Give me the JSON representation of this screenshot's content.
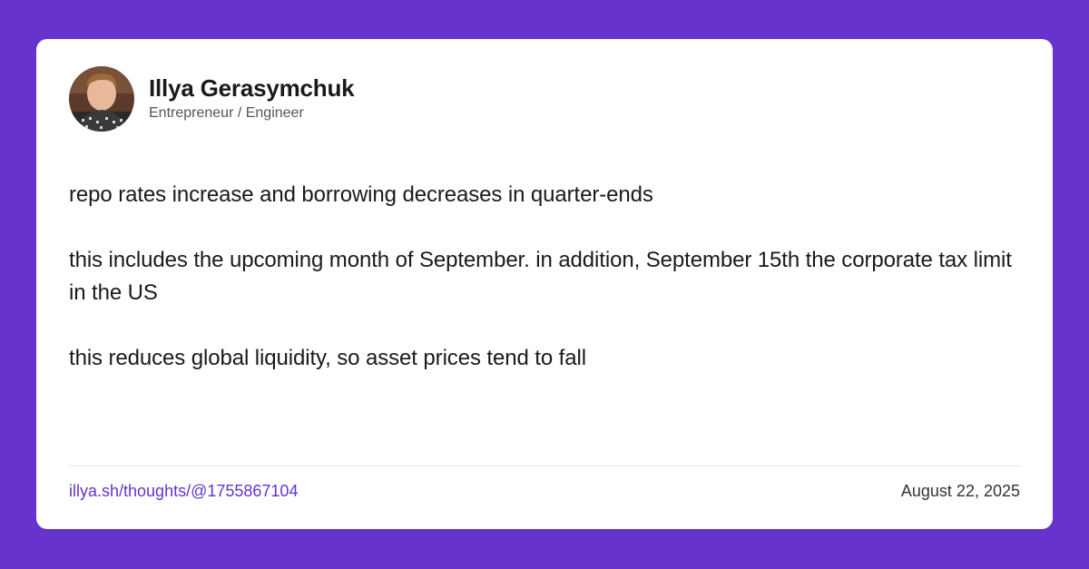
{
  "author": {
    "name": "Illya Gerasymchuk",
    "title": "Entrepreneur / Engineer"
  },
  "post": {
    "paragraphs": [
      "repo rates increase and borrowing decreases in quarter-ends",
      "this includes the upcoming month of September. in addition, September 15th the corporate tax limit in the US",
      "this reduces global liquidity, so asset prices tend to fall"
    ]
  },
  "footer": {
    "link": "illya.sh/thoughts/@1755867104",
    "date": "August 22, 2025"
  },
  "colors": {
    "background": "#6633cc",
    "card": "#ffffff",
    "link": "#6633cc"
  }
}
